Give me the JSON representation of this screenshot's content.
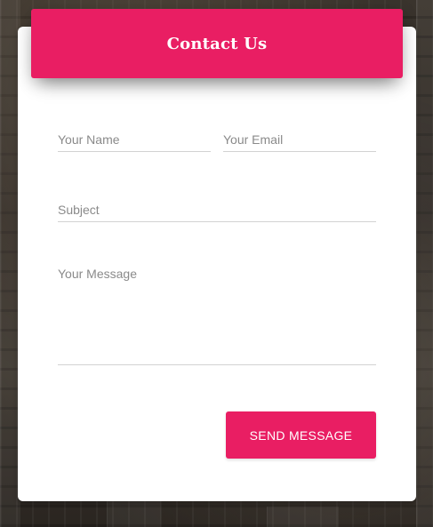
{
  "contact_form": {
    "title": "Contact Us",
    "fields": {
      "name": {
        "placeholder": "Your Name",
        "value": ""
      },
      "email": {
        "placeholder": "Your Email",
        "value": ""
      },
      "subject": {
        "placeholder": "Subject",
        "value": ""
      },
      "message": {
        "placeholder": "Your Message",
        "value": ""
      }
    },
    "submit_label": "SEND MESSAGE"
  },
  "colors": {
    "accent": "#e91e63",
    "card_background": "#ffffff",
    "placeholder_text": "#8a8a8a",
    "field_underline": "#d2d2d2"
  }
}
